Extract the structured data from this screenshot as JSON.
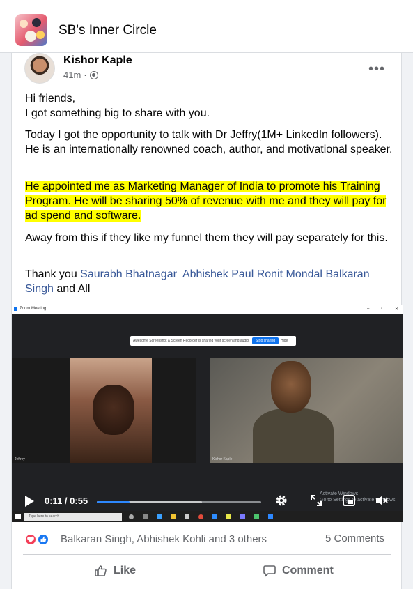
{
  "group": {
    "name": "SB's Inner Circle"
  },
  "post": {
    "author": "Kishor Kaple",
    "time": "41m",
    "privacy_icon": "friends-icon",
    "paragraph1": "Hi friends,\nI got something big to share with you.",
    "paragraph2": "Today I got the opportunity to talk with Dr Jeffry(1M+ LinkedIn followers). He is an internationally renowned coach, author, and motivational speaker.",
    "paragraph3_highlight": "He appointed me as Marketing Manager of India to promote his Training Program. He will be sharing 50% of revenue with me and they will pay for ad spend and software. ",
    "paragraph4": "Away from this if they like my funnel them they will pay separately for this.",
    "thanks_prefix": "Thank you ",
    "mentions": [
      "Saurabh Bhatnagar",
      "Abhishek Paul",
      "Ronit Mondal",
      "Balkaran Singh"
    ],
    "thanks_suffix": " and All"
  },
  "video": {
    "window_title": "Zoom Meeting",
    "share_banner": "Awesome Screenshot & Screen Recorder is sharing your screen and audio.",
    "stop_sharing": "Stop sharing",
    "hide": "Hide",
    "left_participant": "Jeffrey",
    "right_participant": "Kishor Kaple",
    "watermark_line1": "Activate Windows",
    "watermark_line2": "Go to Settings to activate Windows.",
    "taskbar_search": "Type here to search",
    "current_time": "0:11",
    "duration": "0:55",
    "time_display": "0:11 / 0:55",
    "progress": 0.2,
    "buffered": 0.64
  },
  "reactions": {
    "icons": [
      "love-icon",
      "like-icon"
    ],
    "names": "Balkaran Singh, Abhishek Kohli and 3 others",
    "comments": "5 Comments"
  },
  "actions": {
    "like": "Like",
    "comment": "Comment"
  },
  "colors": {
    "link": "#385898",
    "highlight": "#ffff00",
    "like_blue": "#1877f2",
    "love_red": "#f33e58"
  }
}
